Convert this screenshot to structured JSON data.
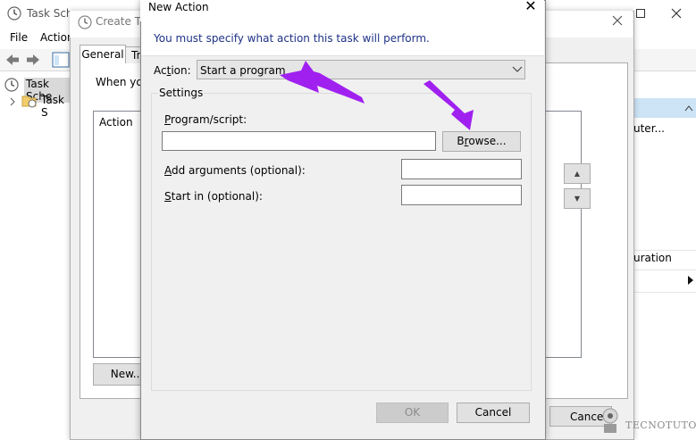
{
  "task_scheduler": {
    "title": "Task Sche",
    "menu": [
      "File",
      "Action"
    ],
    "tree_root": "Task Sche",
    "tree_child": "Task S",
    "right_items": [
      "uter...",
      "uration"
    ]
  },
  "create_task": {
    "title": "Create Tas",
    "tabs": [
      "General",
      "Tr"
    ],
    "intro_text": "When you",
    "action_column": "Action",
    "new_button": "New...",
    "cancel_button": "Cancel"
  },
  "new_action": {
    "title": "New Action",
    "close_icon": "✕",
    "instruction": "You must specify what action this task will perform.",
    "action_label_prefix": "Ac",
    "action_label_underline": "t",
    "action_label_suffix": "ion:",
    "action_value": "Start a program",
    "settings_label": "Settings",
    "program_label_prefix": "",
    "program_label_underline": "P",
    "program_label_suffix": "rogram/script:",
    "program_value": "",
    "browse_label_prefix": "B",
    "browse_label_underline": "r",
    "browse_label_suffix": "owse...",
    "args_label_prefix": "",
    "args_label_underline": "A",
    "args_label_suffix": "dd arguments (optional):",
    "args_value": "",
    "startin_label_prefix": "",
    "startin_label_underline": "S",
    "startin_label_suffix": "tart in (optional):",
    "startin_value": "",
    "ok_button": "OK",
    "cancel_button": "Cancel"
  },
  "watermark": "TECNOTUTO",
  "colors": {
    "annotation_arrow": "#a020f0",
    "instruction_text": "#1e3287",
    "selection": "#cde4f7"
  },
  "icons": {
    "clock": "clock-icon",
    "back": "back-arrow-icon",
    "forward": "forward-arrow-icon",
    "folder": "folder-clock-icon",
    "chevron": "chevron-down-icon",
    "up": "triangle-up-icon",
    "down": "triangle-down-icon"
  }
}
